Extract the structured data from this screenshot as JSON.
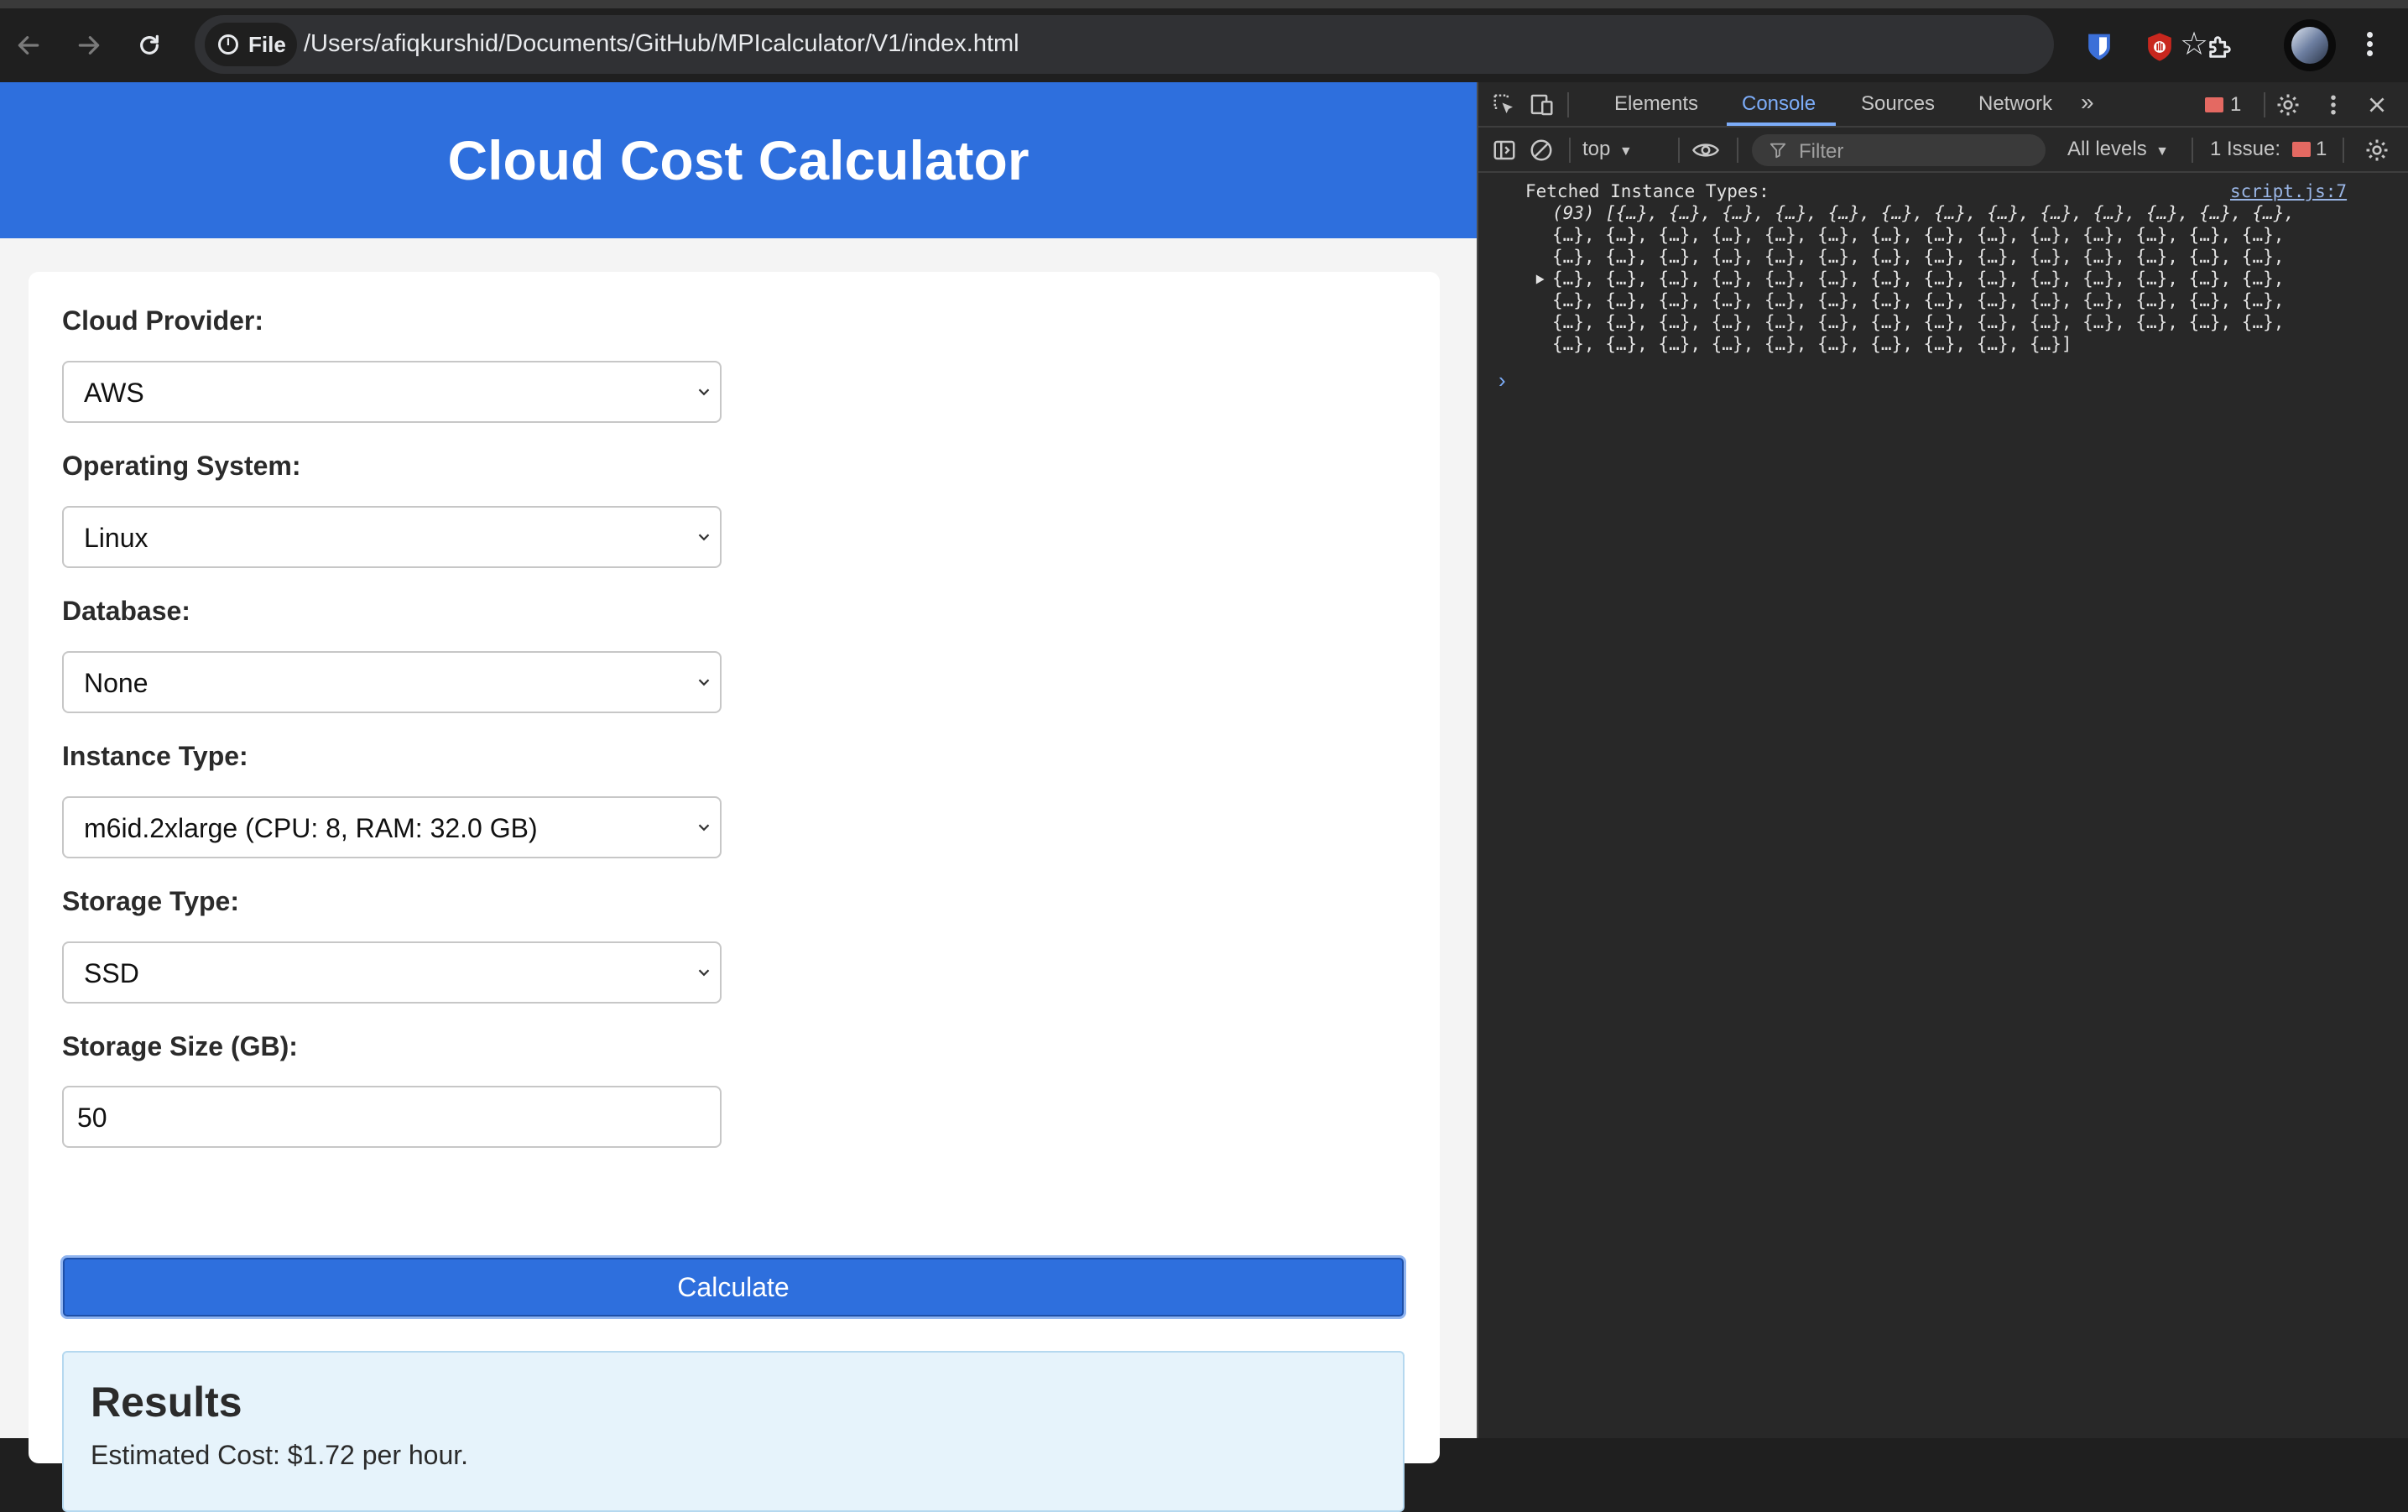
{
  "browser": {
    "file_chip": "File",
    "url": "/Users/afiqkurshid/Documents/GitHub/MPIcalculator/V1/index.html"
  },
  "page": {
    "title": "Cloud Cost Calculator",
    "fields": [
      {
        "label": "Cloud Provider:",
        "value": "AWS"
      },
      {
        "label": "Operating System:",
        "value": "Linux"
      },
      {
        "label": "Database:",
        "value": "None"
      },
      {
        "label": "Instance Type:",
        "value": "m6id.2xlarge (CPU: 8, RAM: 32.0 GB)"
      },
      {
        "label": "Storage Type:",
        "value": "SSD"
      }
    ],
    "storage_size": {
      "label": "Storage Size (GB):",
      "value": "50"
    },
    "calculate_label": "Calculate",
    "results": {
      "title": "Results",
      "text": "Estimated Cost: $1.72 per hour."
    }
  },
  "devtools": {
    "tabs": [
      "Elements",
      "Console",
      "Sources",
      "Network"
    ],
    "active_tab": "Console",
    "error_count": "1",
    "context": "top",
    "filter_placeholder": "Filter",
    "levels": "All levels",
    "issues_label": "1 Issue:",
    "issues_count": "1",
    "log": {
      "message": "Fetched Instance Types:",
      "source": "script.js:7",
      "lines": [
        "(93) [{…}, {…}, {…}, {…}, {…}, {…}, {…}, {…}, {…}, {…}, {…}, {…}, {…},",
        "{…}, {…}, {…}, {…}, {…}, {…}, {…}, {…}, {…}, {…}, {…}, {…}, {…}, {…},",
        "{…}, {…}, {…}, {…}, {…}, {…}, {…}, {…}, {…}, {…}, {…}, {…}, {…}, {…},",
        "{…}, {…}, {…}, {…}, {…}, {…}, {…}, {…}, {…}, {…}, {…}, {…}, {…}, {…},",
        "{…}, {…}, {…}, {…}, {…}, {…}, {…}, {…}, {…}, {…}, {…}, {…}, {…}, {…},",
        "{…}, {…}, {…}, {…}, {…}, {…}, {…}, {…}, {…}, {…}, {…}, {…}, {…}, {…},",
        "{…}, {…}, {…}, {…}, {…}, {…}, {…}, {…}, {…}, {…}]"
      ]
    }
  }
}
